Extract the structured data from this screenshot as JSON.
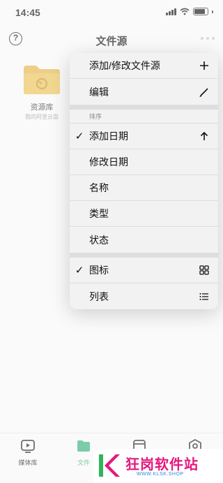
{
  "status_bar": {
    "time": "14:45"
  },
  "header": {
    "title": "文件源",
    "help_icon": "question-circle-icon",
    "more_icon": "ellipsis-icon"
  },
  "folder": {
    "name": "资源库",
    "subtitle": "我的阿里云盘",
    "icon": "folder-icon",
    "color": "#e3b445"
  },
  "menu": {
    "actions": [
      {
        "label": "添加/修改文件源",
        "icon": "plus-icon"
      },
      {
        "label": "编辑",
        "icon": "pencil-icon"
      }
    ],
    "sort_header": "排序",
    "sort_options": [
      {
        "label": "添加日期",
        "checked": true,
        "icon": "arrow-up-icon"
      },
      {
        "label": "修改日期",
        "checked": false
      },
      {
        "label": "名称",
        "checked": false
      },
      {
        "label": "类型",
        "checked": false
      },
      {
        "label": "状态",
        "checked": false
      }
    ],
    "view_options": [
      {
        "label": "图标",
        "checked": true,
        "icon": "grid-icon"
      },
      {
        "label": "列表",
        "checked": false,
        "icon": "list-icon"
      }
    ],
    "check_mark": "✓"
  },
  "tabs": [
    {
      "label": "媒体库",
      "icon": "play-tv-icon",
      "active": false
    },
    {
      "label": "文件",
      "icon": "folder-tab-icon",
      "active": true
    },
    {
      "label": "",
      "icon": "inbox-icon",
      "active": false
    },
    {
      "label": "",
      "icon": "settings-icon",
      "active": false
    }
  ],
  "watermark": {
    "brand": "狂岗软件站",
    "url": "WWW.KLSK.SHOP",
    "logo_letter": "K"
  },
  "colors": {
    "accent": "#34b27a",
    "watermark_pink": "#e5177e",
    "watermark_blue": "#2c8ad8"
  }
}
